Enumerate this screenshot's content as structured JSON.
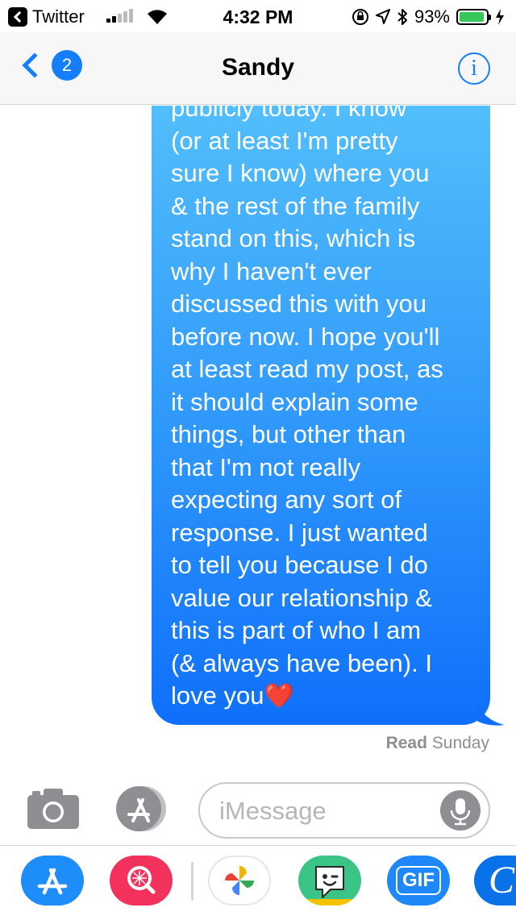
{
  "status_bar": {
    "back_app": "Twitter",
    "time": "4:32 PM",
    "battery_percent": "93%",
    "battery_level": 0.93,
    "signal_bars": 2
  },
  "nav": {
    "back_badge": "2",
    "contact_name": "Sandy",
    "info_glyph": "i"
  },
  "conversation": {
    "message_text": "publicly today. I know\n(or at least I'm pretty\nsure I know) where you\n& the rest of the family\nstand on this, which is\nwhy I haven't ever\ndiscussed this with you\nbefore now. I hope you'll\nat least read my post, as\nit should explain some\nthings, but other than\nthat I'm not really\nexpecting any sort of\nresponse. I just wanted\nto tell you because I do\nvalue our relationship &\nthis is part of who I am\n(& always have been). I\nlove you",
    "message_emoji": "❤️",
    "receipt_status": "Read",
    "receipt_day": "Sunday"
  },
  "composer": {
    "placeholder": "iMessage"
  },
  "app_drawer": {
    "apps": [
      {
        "name": "app-store-icon"
      },
      {
        "name": "image-search-icon"
      },
      {
        "name": "photos-icon"
      },
      {
        "name": "bitmoji-icon"
      },
      {
        "name": "gif-icon",
        "label": "GIF"
      },
      {
        "name": "cursive-icon",
        "label": "C"
      }
    ]
  },
  "colors": {
    "accent": "#147efb",
    "bubble_top": "#55c1fb",
    "bubble_bottom": "#0f6ffb",
    "battery": "#37c759"
  }
}
